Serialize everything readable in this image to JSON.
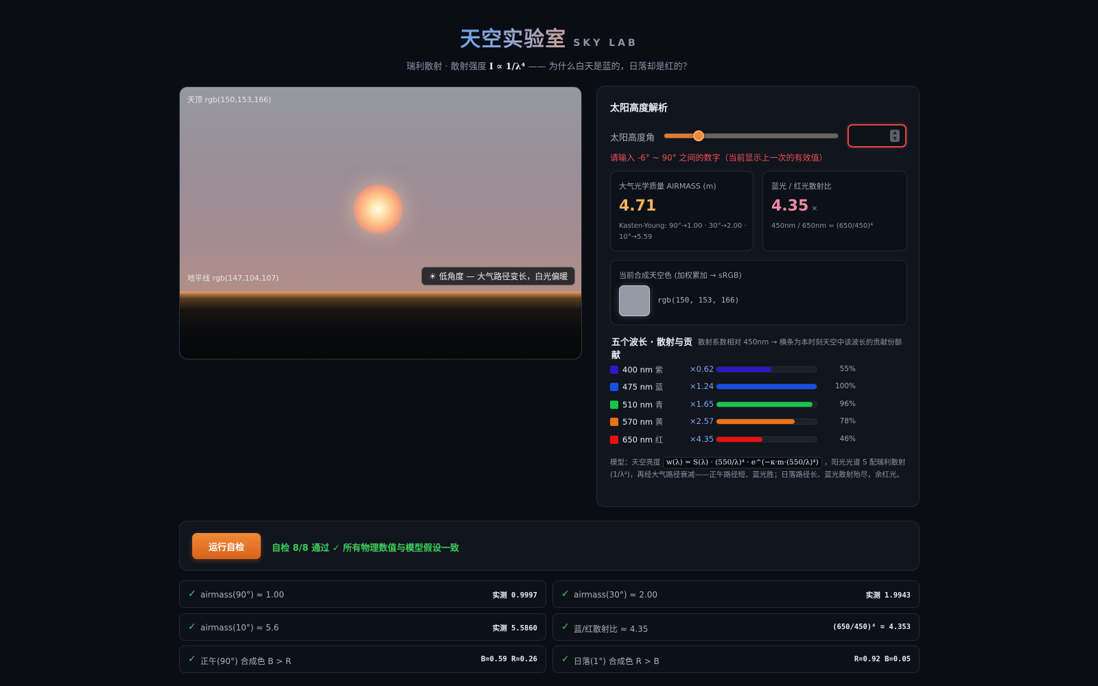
{
  "header": {
    "title_zh": "天空实验室",
    "title_en": "SKY LAB",
    "subtitle_pre": "瑞利散射 · 散射强度",
    "subtitle_formula": "I ∝ 1/λ⁴",
    "subtitle_post": "—— 为什么白天是蓝的，日落却是红的？"
  },
  "sky": {
    "top_label": "天顶 rgb(150,153,166)",
    "horizon_label": "地平线 rgb(147,104,107)",
    "badge_icon": "sun-icon",
    "badge_text": "低角度 — 大气路径变长，白光偏暖"
  },
  "panel": {
    "title": "太阳高度解析",
    "slider_label": "太阳高度角",
    "slider_fraction": 0.2,
    "input_value": "",
    "error": "请输入 -6° ~ 90° 之间的数字（当前显示上一次的有效值）",
    "airmass": {
      "label": "大气光学质量 AIRMASS (m)",
      "value": "4.71",
      "note": "Kasten-Young: 90°→1.00 · 30°→2.00 · 10°→5.59"
    },
    "ratio": {
      "label": "蓝光 / 红光散射比",
      "value": "4.35",
      "unit": "×",
      "note": "450nm / 650nm = (650/450)⁴"
    },
    "sky_color": {
      "label": "当前合成天空色 (加权累加 → sRGB)",
      "value": "rgb(150, 153, 166)",
      "swatch": "#9699a6"
    },
    "wavelengths": {
      "title": "五个波长 · 散射与贡献",
      "desc": "散射系数相对 450nm → 横条为本时刻天空中该波长的贡献份额",
      "items": [
        {
          "nm": "400 nm",
          "name": "紫",
          "mult": "×0.62",
          "pct": "55%",
          "share": 0.55,
          "color": "#2f16c8"
        },
        {
          "nm": "475 nm",
          "name": "蓝",
          "mult": "×1.24",
          "pct": "100%",
          "share": 1.0,
          "color": "#1550e6"
        },
        {
          "nm": "510 nm",
          "name": "青",
          "mult": "×1.65",
          "pct": "96%",
          "share": 0.96,
          "color": "#18c44a"
        },
        {
          "nm": "570 nm",
          "name": "黄",
          "mult": "×2.57",
          "pct": "78%",
          "share": 0.78,
          "color": "#f2700e"
        },
        {
          "nm": "650 nm",
          "name": "红",
          "mult": "×4.35",
          "pct": "46%",
          "share": 0.46,
          "color": "#ec1010"
        }
      ]
    },
    "model": {
      "pre": "模型：天空亮度",
      "formula": "w(λ) = S(λ) · (550/λ)⁴ · e^(−κ·m·(550/λ)⁴)",
      "post": "，阳光光谱 S 配瑞利散射 (1/λ⁴)，再经大气路径衰减——正午路径短、蓝光胜；日落路径长、蓝光散射殆尽，余红光。"
    }
  },
  "selftest": {
    "button": "运行自检",
    "status": "自检 8/8 通过 ✓ 所有物理数值与模型假设一致",
    "checks": [
      {
        "label": "airmass(90°) ≈ 1.00",
        "value": "实测 0.9997"
      },
      {
        "label": "airmass(30°) ≈ 2.00",
        "value": "实测 1.9943"
      },
      {
        "label": "airmass(10°) ≈ 5.6",
        "value": "实测 5.5860"
      },
      {
        "label": "蓝/红散射比 ≈ 4.35",
        "value": "(650/450)⁴ = 4.353"
      },
      {
        "label": "正午(90°) 合成色 B > R",
        "value": "B=0.59 R=0.26"
      },
      {
        "label": "日落(1°) 合成色 R > B",
        "value": "R=0.92 B=0.05"
      }
    ]
  }
}
